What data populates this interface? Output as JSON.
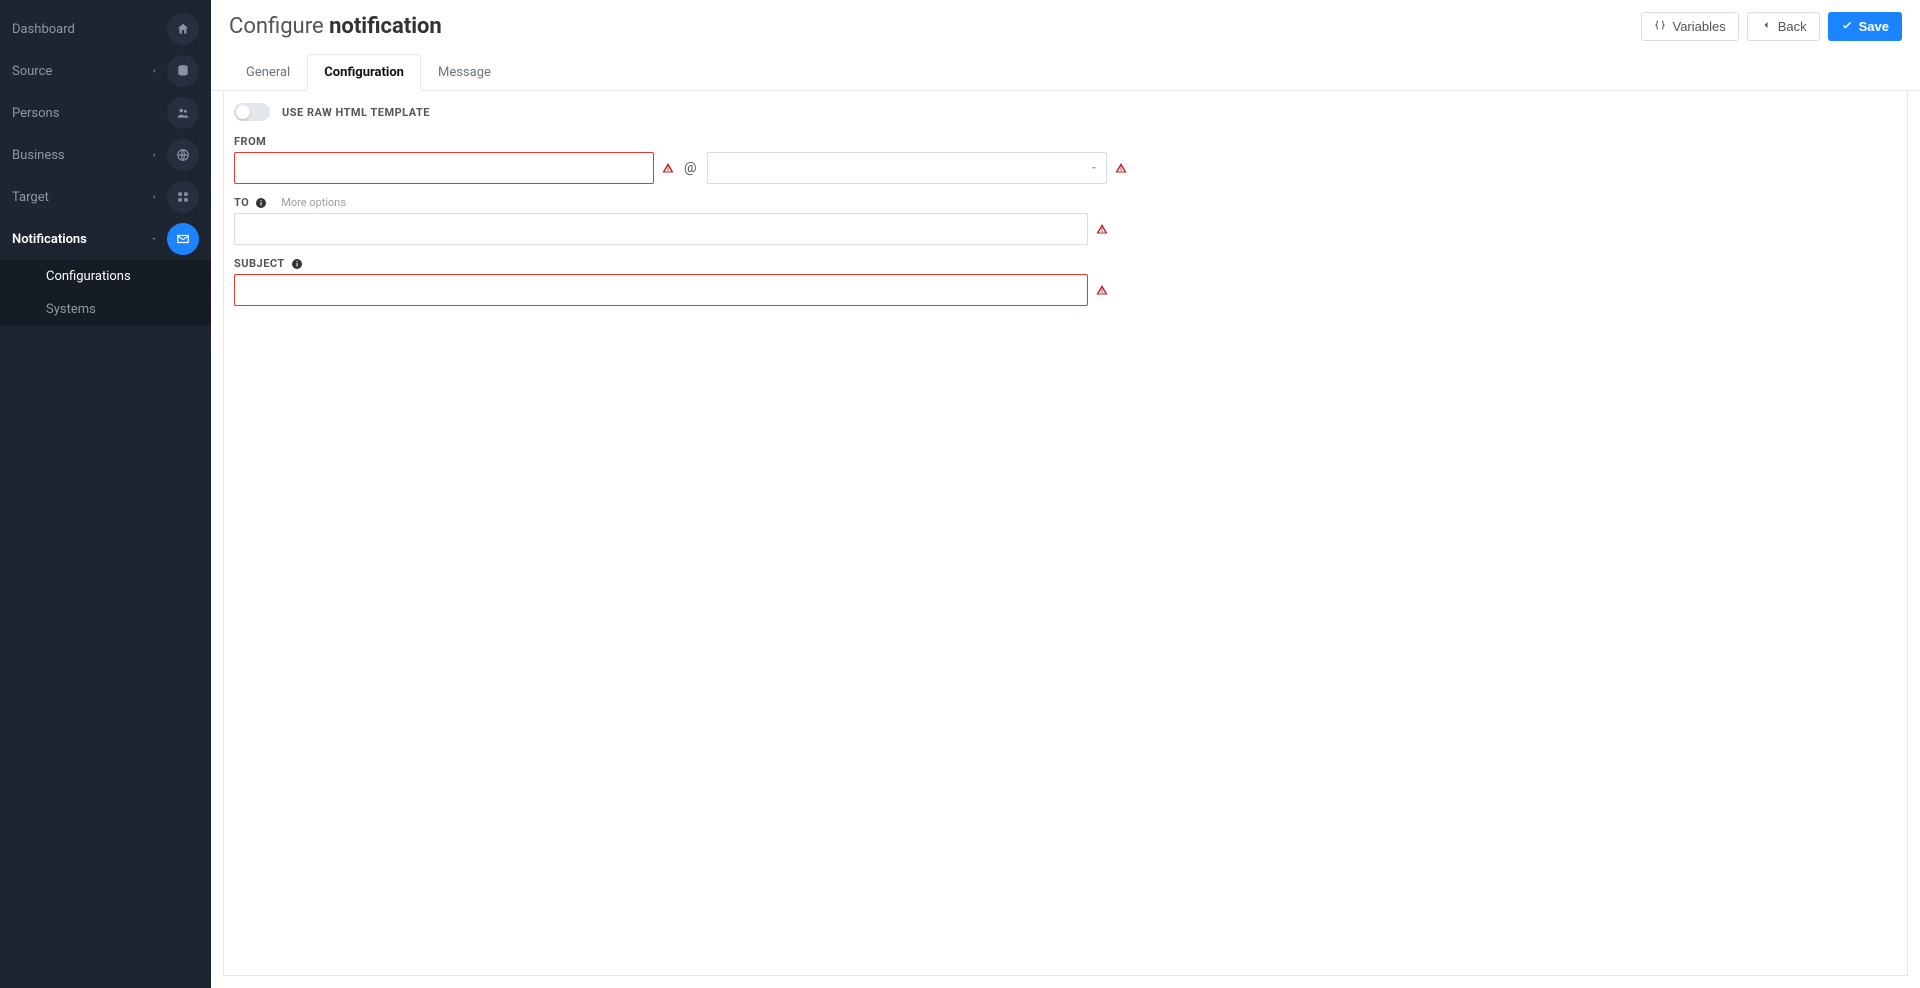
{
  "sidebar": {
    "items": [
      {
        "label": "Dashboard",
        "icon": "home",
        "expandable": false,
        "active": false
      },
      {
        "label": "Source",
        "icon": "database",
        "expandable": true,
        "active": false
      },
      {
        "label": "Persons",
        "icon": "users",
        "expandable": false,
        "active": false
      },
      {
        "label": "Business",
        "icon": "globe",
        "expandable": true,
        "active": false
      },
      {
        "label": "Target",
        "icon": "grid",
        "expandable": true,
        "active": false
      },
      {
        "label": "Notifications",
        "icon": "mail",
        "expandable": true,
        "active": true
      }
    ],
    "sub": {
      "configurations": "Configurations",
      "systems": "Systems"
    }
  },
  "header": {
    "title_light": "Configure",
    "title_bold": "notification",
    "actions": {
      "variables": "Variables",
      "back": "Back",
      "save": "Save"
    }
  },
  "tabs": {
    "general": "General",
    "configuration": "Configuration",
    "message": "Message",
    "active": "configuration"
  },
  "form": {
    "raw_html_label": "USE RAW HTML TEMPLATE",
    "raw_html_enabled": false,
    "from_label": "FROM",
    "from_value": "",
    "at_symbol": "@",
    "domain_value": "",
    "to_label": "TO",
    "to_more": "More options",
    "to_value": "",
    "subject_label": "SUBJECT",
    "subject_value": "",
    "errors": {
      "from": true,
      "domain": true,
      "to": true,
      "subject": true
    }
  },
  "colors": {
    "accent": "#1c84ff",
    "error": "#bd2323",
    "sidebar_bg": "#1d2531"
  }
}
